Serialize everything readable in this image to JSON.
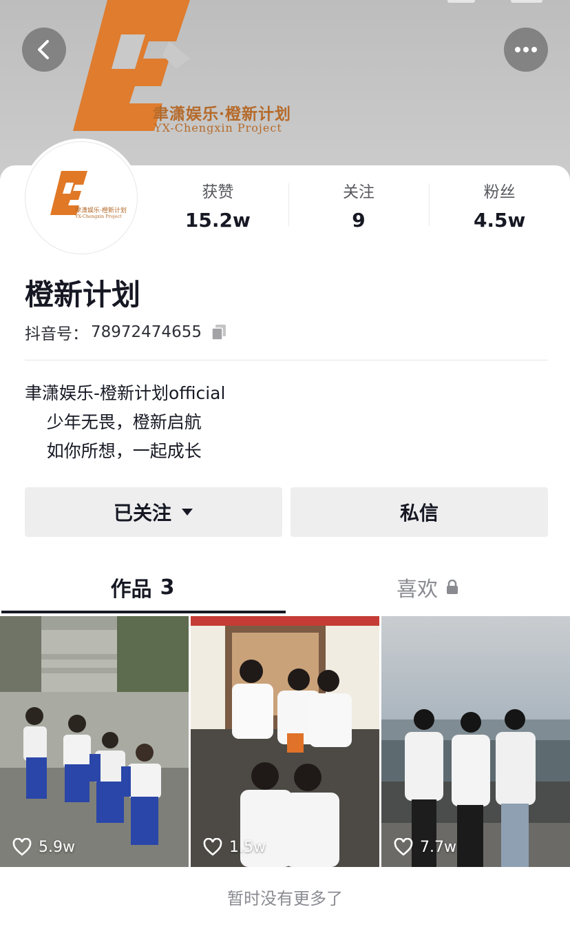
{
  "cover": {
    "brand_cn": "聿潇娱乐·橙新计划",
    "brand_en": "YX-Chengxin Project"
  },
  "nav": {
    "back_icon": "chevron-left-icon",
    "more_icon": "more-dots-icon"
  },
  "avatar": {
    "brand_cn": "聿潇娱乐·橙新计划",
    "brand_en": "YX-Chengxin Project"
  },
  "stats": [
    {
      "label": "获赞",
      "value": "15.2w"
    },
    {
      "label": "关注",
      "value": "9"
    },
    {
      "label": "粉丝",
      "value": "4.5w"
    }
  ],
  "profile": {
    "nickname": "橙新计划",
    "douyin_id_label": "抖音号：",
    "douyin_id": "78972474655",
    "bio_lines": [
      "聿潇娱乐-橙新计划official",
      "    少年无畏，橙新启航",
      "    如你所想，一起成长"
    ]
  },
  "actions": {
    "follow_label": "已关注",
    "message_label": "私信"
  },
  "tabs": {
    "works_label": "作品",
    "works_count": "3",
    "likes_label": "喜欢"
  },
  "videos": [
    {
      "likes": "5.9w"
    },
    {
      "likes": "1.5w"
    },
    {
      "likes": "7.7w"
    }
  ],
  "footer": {
    "note": "暂时没有更多了"
  },
  "colors": {
    "brand_orange": "#e07826",
    "text_primary": "#161823",
    "text_secondary": "#8a8b91",
    "button_bg": "#eeeeef"
  }
}
